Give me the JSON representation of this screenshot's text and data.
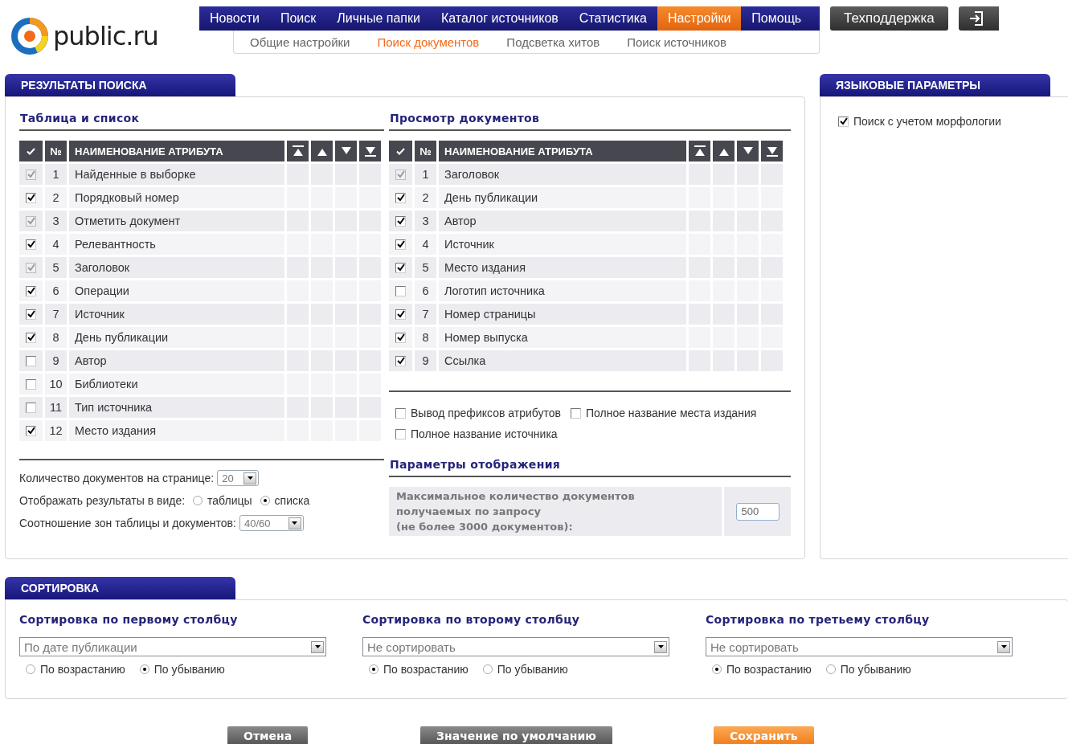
{
  "logo": {
    "text": "public.ru"
  },
  "nav": [
    {
      "label": "Новости",
      "selected": false
    },
    {
      "label": "Поиск",
      "selected": false
    },
    {
      "label": "Личные папки",
      "selected": false
    },
    {
      "label": "Каталог источников",
      "selected": false
    },
    {
      "label": "Статистика",
      "selected": false
    },
    {
      "label": "Настройки",
      "selected": true
    },
    {
      "label": "Помощь",
      "selected": false
    }
  ],
  "support_button": "Техподдержка",
  "subnav": [
    {
      "label": "Общие настройки",
      "selected": false
    },
    {
      "label": "Поиск документов",
      "selected": true
    },
    {
      "label": "Подсветка хитов",
      "selected": false
    },
    {
      "label": "Поиск источников",
      "selected": false
    }
  ],
  "results_panel": {
    "title": "РЕЗУЛЬТАТЫ ПОИСКА",
    "list_table": {
      "heading": "Таблица и список",
      "columns": [
        "№",
        "НАИМЕНОВАНИЕ АТРИБУТА"
      ],
      "rows": [
        {
          "checked": true,
          "disabled": true,
          "number": "1",
          "name": "Найденные в выборке"
        },
        {
          "checked": true,
          "disabled": false,
          "number": "2",
          "name": "Порядковый номер"
        },
        {
          "checked": true,
          "disabled": true,
          "number": "3",
          "name": "Отметить документ"
        },
        {
          "checked": true,
          "disabled": false,
          "number": "4",
          "name": "Релевантность"
        },
        {
          "checked": true,
          "disabled": true,
          "number": "5",
          "name": "Заголовок"
        },
        {
          "checked": true,
          "disabled": false,
          "number": "6",
          "name": "Операции"
        },
        {
          "checked": true,
          "disabled": false,
          "number": "7",
          "name": "Источник"
        },
        {
          "checked": true,
          "disabled": false,
          "number": "8",
          "name": "День публикации"
        },
        {
          "checked": false,
          "disabled": false,
          "number": "9",
          "name": "Автор"
        },
        {
          "checked": false,
          "disabled": false,
          "number": "10",
          "name": "Библиотеки"
        },
        {
          "checked": false,
          "disabled": false,
          "number": "11",
          "name": "Тип источника"
        },
        {
          "checked": true,
          "disabled": false,
          "number": "12",
          "name": "Место издания"
        }
      ]
    },
    "per_page": {
      "label": "Количество документов на странице:",
      "value": "20"
    },
    "view_mode": {
      "label": "Отображать результаты в виде:",
      "options": [
        {
          "label": "таблицы",
          "selected": false
        },
        {
          "label": "списка",
          "selected": true
        }
      ]
    },
    "zone_ratio": {
      "label": "Соотношение зон таблицы и документов:",
      "value": "40/60"
    },
    "doc_view": {
      "heading": "Просмотр документов",
      "columns": [
        "№",
        "НАИМЕНОВАНИЕ АТРИБУТА"
      ],
      "rows": [
        {
          "checked": true,
          "disabled": true,
          "number": "1",
          "name": "Заголовок"
        },
        {
          "checked": true,
          "disabled": false,
          "number": "2",
          "name": "День публикации"
        },
        {
          "checked": true,
          "disabled": false,
          "number": "3",
          "name": "Автор"
        },
        {
          "checked": true,
          "disabled": false,
          "number": "4",
          "name": "Источник"
        },
        {
          "checked": true,
          "disabled": false,
          "number": "5",
          "name": "Место издания"
        },
        {
          "checked": false,
          "disabled": false,
          "number": "6",
          "name": "Логотип источника"
        },
        {
          "checked": true,
          "disabled": false,
          "number": "7",
          "name": "Номер страницы"
        },
        {
          "checked": true,
          "disabled": false,
          "number": "8",
          "name": "Номер выпуска"
        },
        {
          "checked": true,
          "disabled": false,
          "number": "9",
          "name": "Ссылка"
        }
      ],
      "options": [
        {
          "label": "Вывод префиксов атрибутов",
          "checked": false
        },
        {
          "label": "Полное название места издания",
          "checked": false
        },
        {
          "label": "Полное название источника",
          "checked": false
        }
      ]
    },
    "display": {
      "heading": "Параметры отображения",
      "max_docs_label": [
        "Максимальное количество документов",
        "получаемых по запросу",
        "(не более 3000 документов):"
      ],
      "max_docs_value": "500"
    }
  },
  "language_panel": {
    "title": "ЯЗЫКОВЫЕ ПАРАМЕТРЫ",
    "options": [
      {
        "label": "Поиск с учетом морфологии",
        "checked": true
      }
    ]
  },
  "sorting_panel": {
    "title": "СОРТИРОВКА",
    "columns": [
      {
        "heading": "Сортировка по первому столбцу",
        "value": "По дате публикации",
        "orders": [
          {
            "label": "По возрастанию",
            "selected": false
          },
          {
            "label": "По убыванию",
            "selected": true
          }
        ]
      },
      {
        "heading": "Сортировка по второму столбцу",
        "value": "Не сортировать",
        "orders": [
          {
            "label": "По возрастанию",
            "selected": true
          },
          {
            "label": "По убыванию",
            "selected": false
          }
        ]
      },
      {
        "heading": "Сортировка по третьему столбцу",
        "value": "Не сортировать",
        "orders": [
          {
            "label": "По возрастанию",
            "selected": true
          },
          {
            "label": "По убыванию",
            "selected": false
          }
        ]
      }
    ]
  },
  "buttons": [
    {
      "label": "Отмена",
      "kind": "secondary"
    },
    {
      "label": "Значение по умолчанию",
      "kind": "secondary"
    },
    {
      "label": "Сохранить",
      "kind": "primary"
    }
  ]
}
